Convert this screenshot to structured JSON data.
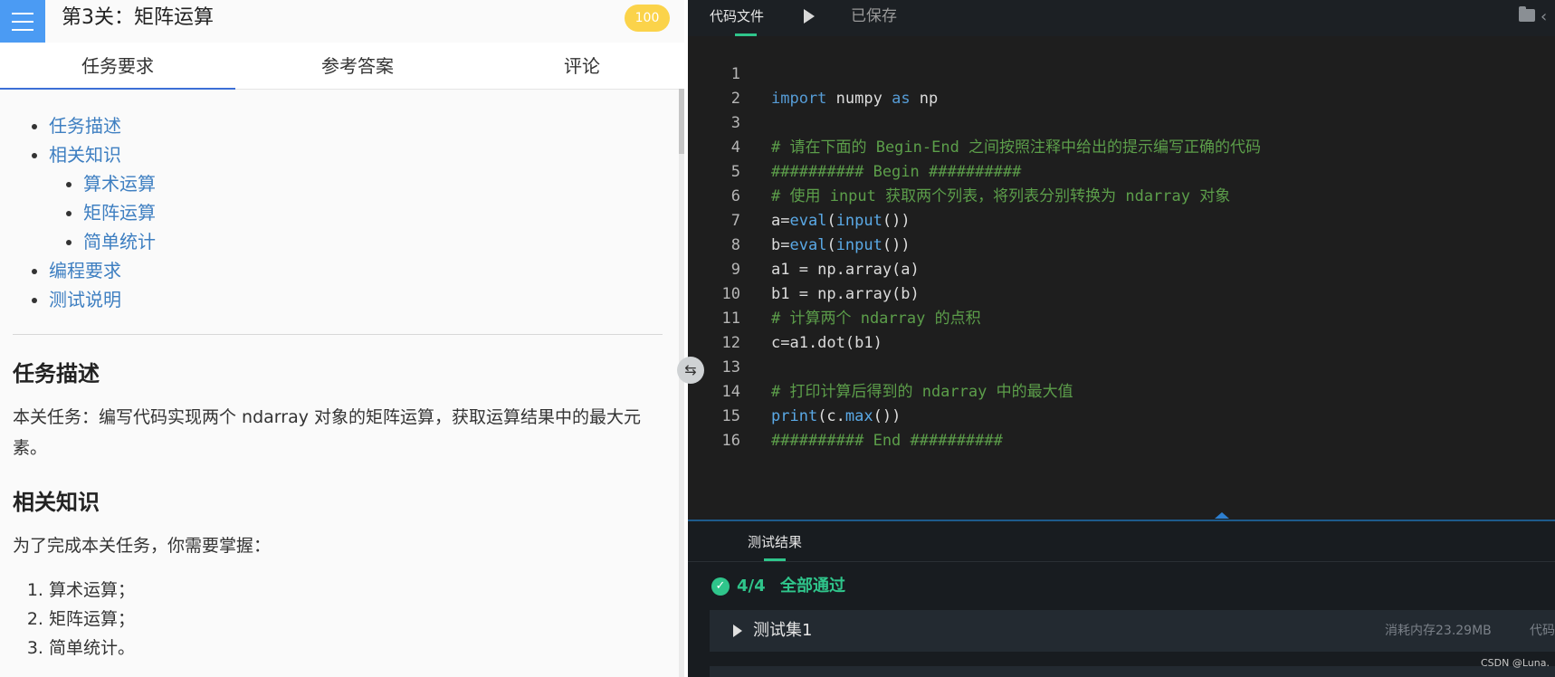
{
  "header": {
    "level_title": "第3关：矩阵运算",
    "score": "100"
  },
  "tabs": [
    {
      "label": "任务要求",
      "active": true
    },
    {
      "label": "参考答案",
      "active": false
    },
    {
      "label": "评论",
      "active": false
    }
  ],
  "toc": {
    "task_description": "任务描述",
    "related_knowledge": "相关知识",
    "sub_arithmetic": "算术运算",
    "sub_matrix": "矩阵运算",
    "sub_statistics": "简单统计",
    "programming_requirements": "编程要求",
    "test_instructions": "测试说明"
  },
  "content": {
    "heading_task": "任务描述",
    "task_text": "本关任务：编写代码实现两个 ndarray 对象的矩阵运算，获取运算结果中的最大元素。",
    "heading_knowledge": "相关知识",
    "knowledge_intro": "为了完成本关任务，你需要掌握：",
    "knowledge_items": [
      "算术运算；",
      "矩阵运算；",
      "简单统计。"
    ]
  },
  "editor": {
    "tab_label": "代码文件",
    "saved_status": "已保存",
    "lines": [
      {
        "n": "1",
        "text": ""
      },
      {
        "n": "2",
        "text": ""
      },
      {
        "n": "3",
        "text": "# 请在下面的 Begin-End 之间按照注释中给出的提示编写正确的代码"
      },
      {
        "n": "4",
        "text": "########## Begin ##########"
      },
      {
        "n": "5",
        "text": "# 使用 input 获取两个列表，将列表分别转换为 ndarray 对象"
      },
      {
        "n": "6",
        "text": ""
      },
      {
        "n": "7",
        "text": ""
      },
      {
        "n": "8",
        "text": "a1 = np.array(a)"
      },
      {
        "n": "9",
        "text": "b1 = np.array(b)"
      },
      {
        "n": "10",
        "text": "# 计算两个 ndarray 的点积"
      },
      {
        "n": "11",
        "text": "c=a1.dot(b1)"
      },
      {
        "n": "12",
        "text": ""
      },
      {
        "n": "13",
        "text": "# 打印计算后得到的 ndarray 中的最大值"
      },
      {
        "n": "14",
        "text": ""
      },
      {
        "n": "15",
        "text": "########## End ##########"
      },
      {
        "n": "16",
        "text": ""
      }
    ],
    "tokens": {
      "import_kw": "import",
      "numpy_mod": " numpy ",
      "as_kw": "as",
      "np_alias": " np",
      "a_assign": "a=",
      "b_assign": "b=",
      "eval_fn": "eval",
      "open_paren": "(",
      "input_fn": "input",
      "close_parens": "())",
      "print_fn": "print",
      "c_dot": "(c.",
      "max_fn": "max",
      "max_close": "())"
    }
  },
  "results": {
    "tab_label": "测试结果",
    "pass_count": "4/4",
    "pass_text": "全部通过",
    "testset_label": "测试集1",
    "memory_text": "消耗内存23.29MB",
    "exec_text": "代码执行",
    "watermark": "CSDN @Luna."
  },
  "colors": {
    "accent_blue": "#4b9bf3",
    "badge_yellow": "#fbd34a",
    "success_green": "#2fc58b",
    "link_blue": "#3e7fc1",
    "editor_bg": "#1e1e1e"
  }
}
